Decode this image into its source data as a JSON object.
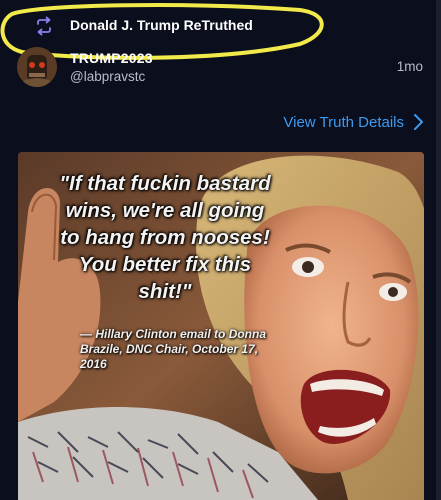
{
  "retruth": {
    "label": "Donald J. Trump ReTruthed"
  },
  "post": {
    "author_name": "TRUMP2023",
    "author_handle": "@labpravstc",
    "timestamp": "1mo",
    "details_link": "View Truth Details"
  },
  "meme": {
    "quote": "\"If that fuckin bastard wins, we're all going to hang from nooses! You better fix this shit!\"",
    "attribution": "— Hillary Clinton email to Donna Brazile, DNC Chair, October 17, 2016"
  },
  "icons": {
    "retruth": "retruth-icon",
    "chevron": "chevron-right-icon",
    "avatar": "avatar"
  },
  "colors": {
    "background": "#0b0e1d",
    "link": "#3d9bf0",
    "highlight": "#f2e94a",
    "retruth_icon": "#8e7cf0"
  }
}
